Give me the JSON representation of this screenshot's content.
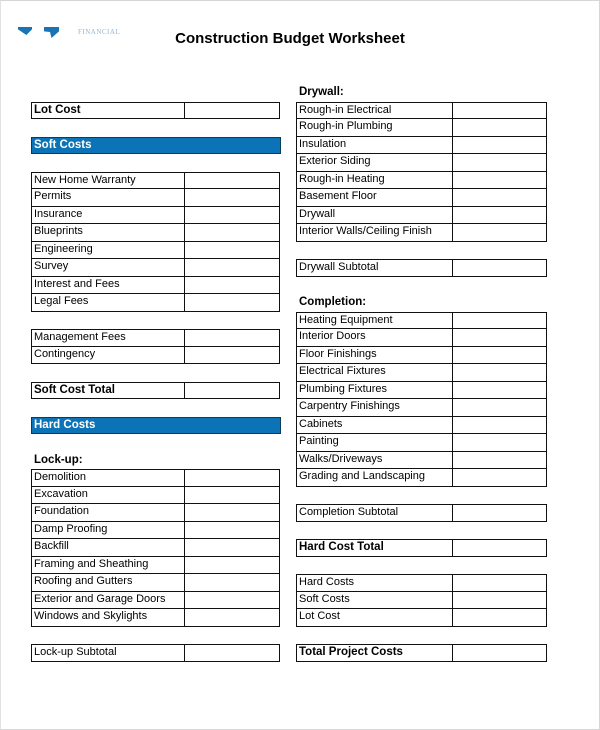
{
  "document": {
    "title": "Construction Budget Worksheet",
    "logo": {
      "icon": "company-logo-icon",
      "wordmark": "FINANCIAL",
      "brand_color": "#1a73b5"
    },
    "accent_color": "#0b73b6"
  },
  "left": {
    "lot_cost": "Lot Cost",
    "soft_costs_header": "Soft Costs",
    "soft_costs_items": [
      "New Home Warranty",
      "Permits",
      "Insurance",
      "Blueprints",
      "Engineering",
      "Survey",
      "Interest and Fees",
      "Legal Fees"
    ],
    "soft_costs_items_2": [
      "Management Fees",
      "Contingency"
    ],
    "soft_cost_total": "Soft Cost Total",
    "hard_costs_header": "Hard Costs",
    "lockup_heading": "Lock-up:",
    "lockup_items": [
      "Demolition",
      "Excavation",
      "Foundation",
      "Damp Proofing",
      "Backfill",
      "Framing and Sheathing",
      "Roofing and Gutters",
      "Exterior and Garage Doors",
      "Windows and Skylights"
    ],
    "lockup_subtotal": "Lock-up Subtotal"
  },
  "right": {
    "drywall_heading": "Drywall:",
    "drywall_items": [
      "Rough-in Electrical",
      "Rough-in Plumbing",
      "Insulation",
      "Exterior Siding",
      "Rough-in Heating",
      "Basement Floor",
      "Drywall",
      "Interior Walls/Ceiling Finish"
    ],
    "drywall_subtotal": "Drywall Subtotal",
    "completion_heading": "Completion:",
    "completion_items": [
      "Heating Equipment",
      "Interior Doors",
      "Floor Finishings",
      "Electrical Fixtures",
      "Plumbing Fixtures",
      "Carpentry Finishings",
      "Cabinets",
      "Painting",
      "Walks/Driveways",
      "Grading and Landscaping"
    ],
    "completion_subtotal": "Completion Subtotal",
    "hard_cost_total": "Hard Cost Total",
    "summary_items": [
      "Hard Costs",
      "Soft Costs",
      "Lot Cost"
    ],
    "total_project_costs": "Total Project Costs"
  }
}
